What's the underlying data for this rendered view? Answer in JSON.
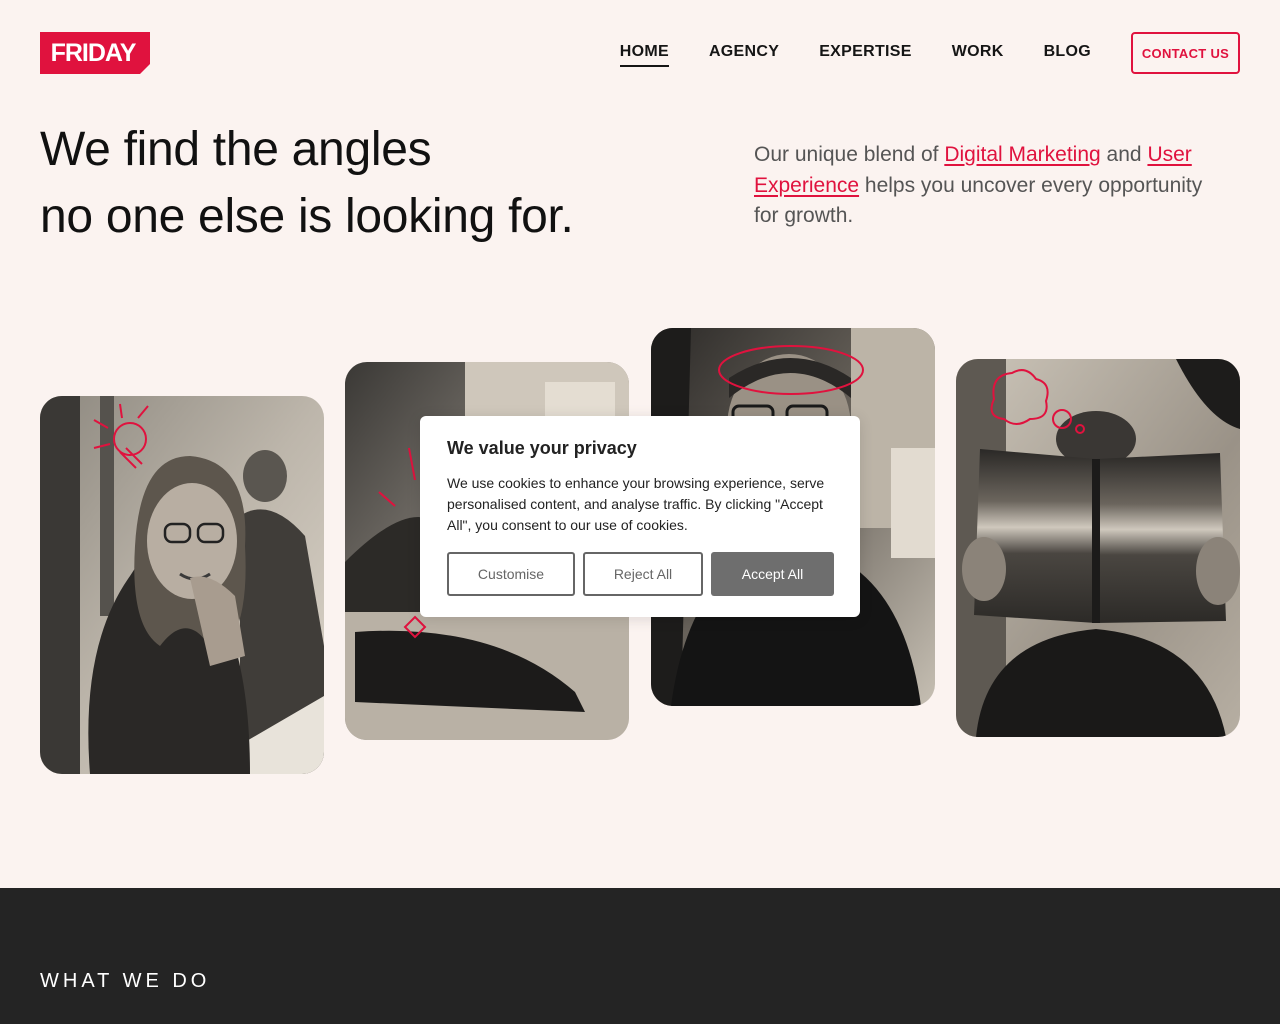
{
  "brand": {
    "name": "FRIDAY",
    "color": "#e0123e"
  },
  "nav": {
    "items": [
      {
        "label": "HOME",
        "active": true
      },
      {
        "label": "AGENCY",
        "active": false
      },
      {
        "label": "EXPERTISE",
        "active": false
      },
      {
        "label": "WORK",
        "active": false
      },
      {
        "label": "BLOG",
        "active": false
      }
    ],
    "cta": "CONTACT US"
  },
  "hero": {
    "headline_line1": "We find the angles",
    "headline_line2": "no one else is looking for.",
    "intro_before": "Our unique blend of ",
    "intro_link1": "Digital Marketing",
    "intro_mid": " and ",
    "intro_link2": "User Experience",
    "intro_after": " helps you uncover every opportunity for growth."
  },
  "photos": [
    {
      "subject": "woman smiling with glasses",
      "doodle": "lightbulb-icon"
    },
    {
      "subject": "person at laptop",
      "doodle": "sparkle-icon"
    },
    {
      "subject": "man with glasses",
      "doodle": "halo-icon"
    },
    {
      "subject": "person reading a book",
      "doodle": "thought-cloud-icon"
    }
  ],
  "cookie": {
    "title": "We value your privacy",
    "body": "We use cookies to enhance your browsing experience, serve personalised content, and analyse traffic. By clicking \"Accept All\", you consent to our use of cookies.",
    "customise": "Customise",
    "reject": "Reject All",
    "accept": "Accept All"
  },
  "section": {
    "title": "WHAT WE DO"
  }
}
